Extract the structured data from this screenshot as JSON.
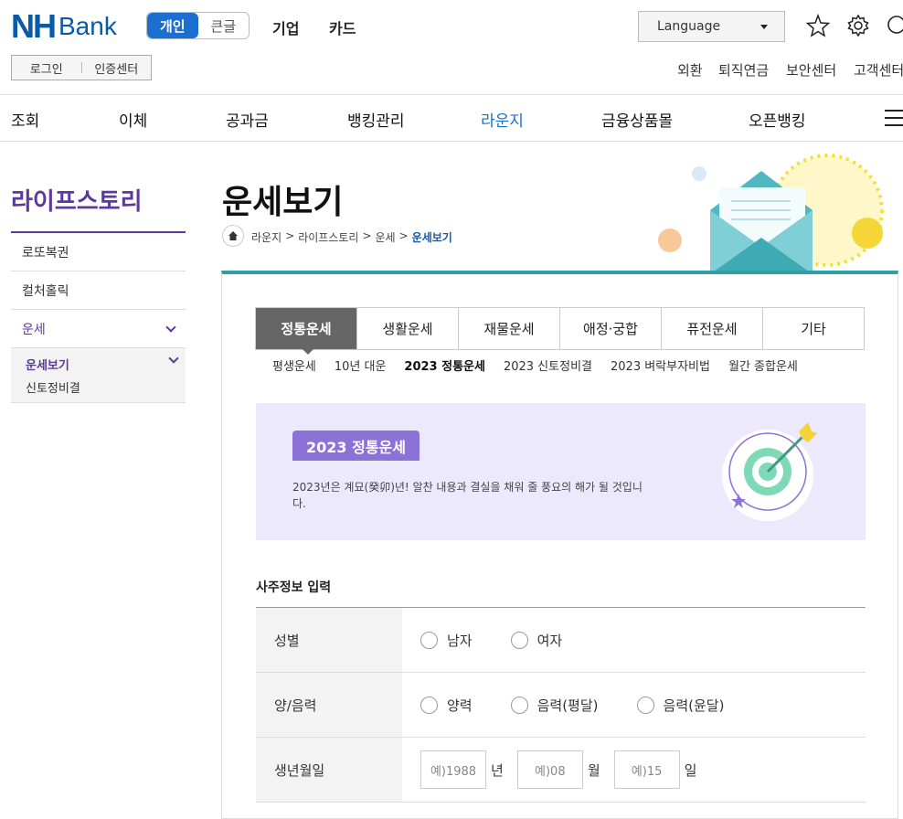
{
  "header": {
    "logo_nh": "NH",
    "logo_bank": "Bank",
    "segment": [
      "개인",
      "큰글"
    ],
    "top_links": [
      "기업",
      "카드"
    ],
    "language": "Language",
    "login": "로그인",
    "cert": "인증센터",
    "util_links": [
      "외환",
      "퇴직연금",
      "보안센터",
      "고객센터"
    ]
  },
  "nav": [
    "조회",
    "이체",
    "공과금",
    "뱅킹관리",
    "라운지",
    "금융상품몰",
    "오픈뱅킹"
  ],
  "sidebar": {
    "title": "라이프스토리",
    "items": [
      "로또복권",
      "컬처홀릭",
      "운세"
    ],
    "sub": [
      "운세보기",
      "신토정비결"
    ]
  },
  "page": {
    "title": "운세보기",
    "breadcrumb": [
      "라운지",
      "라이프스토리",
      "운세",
      "운세보기"
    ]
  },
  "tabs": [
    "정통운세",
    "생활운세",
    "재물운세",
    "애정·궁합",
    "퓨전운세",
    "기타"
  ],
  "subtabs": [
    "평생운세",
    "10년 대운",
    "2023 정통운세",
    "2023 신토정비결",
    "2023 벼락부자비법",
    "월간 종합운세"
  ],
  "banner": {
    "badge": "2023 정통운세",
    "text": "2023년은 계묘(癸卯)년! 알찬 내용과 결실을 채워 줄 풍요의 해가 될 것입니다."
  },
  "form": {
    "heading": "사주정보 입력",
    "gender_label": "성별",
    "gender_options": [
      "남자",
      "여자"
    ],
    "calendar_label": "양/음력",
    "calendar_options": [
      "양력",
      "음력(평달)",
      "음력(윤달)"
    ],
    "birth_label": "생년월일",
    "year_placeholder": "예)1988",
    "year_unit": "년",
    "month_placeholder": "예)08",
    "month_unit": "월",
    "day_placeholder": "예)15",
    "day_unit": "일"
  },
  "colors": {
    "brand_blue": "#0a5aaa",
    "accent_purple": "#5b3a9c",
    "teal": "#2e9fa6",
    "banner_bg": "#ece9fd"
  }
}
